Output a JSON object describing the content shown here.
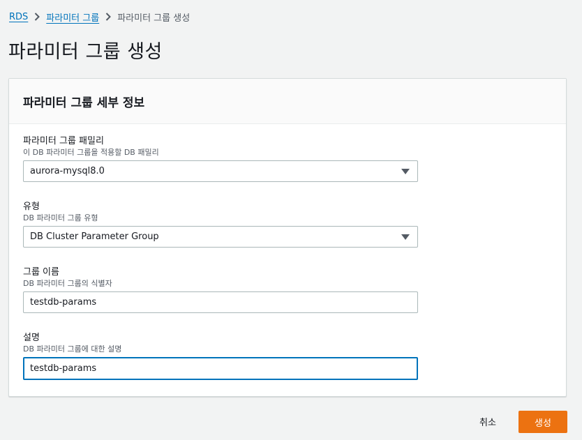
{
  "breadcrumb": {
    "items": [
      "RDS",
      "파라미터 그룹",
      "파라미터 그룹 생성"
    ]
  },
  "page": {
    "title": "파라미터 그룹 생성"
  },
  "panel": {
    "title": "파라미터 그룹 세부 정보",
    "fields": {
      "family": {
        "label": "파라미터 그룹 패밀리",
        "description": "이 DB 파라미터 그룹을 적용할 DB 패밀리",
        "value": "aurora-mysql8.0"
      },
      "type": {
        "label": "유형",
        "description": "DB 파라미터 그룹 유형",
        "value": "DB Cluster Parameter Group"
      },
      "name": {
        "label": "그룹 이름",
        "description": "DB 파라미터 그룹의 식별자",
        "value": "testdb-params"
      },
      "description": {
        "label": "설명",
        "description": "DB 파라미터 그룹에 대한 설명",
        "value": "testdb-params"
      }
    }
  },
  "actions": {
    "cancel_label": "취소",
    "create_label": "생성"
  },
  "colors": {
    "accent": "#ec7211",
    "link": "#0073bb",
    "focus": "#0073bb"
  },
  "icons": {
    "breadcrumb_separator": "chevron-right-icon",
    "select_caret": "caret-down-icon"
  }
}
